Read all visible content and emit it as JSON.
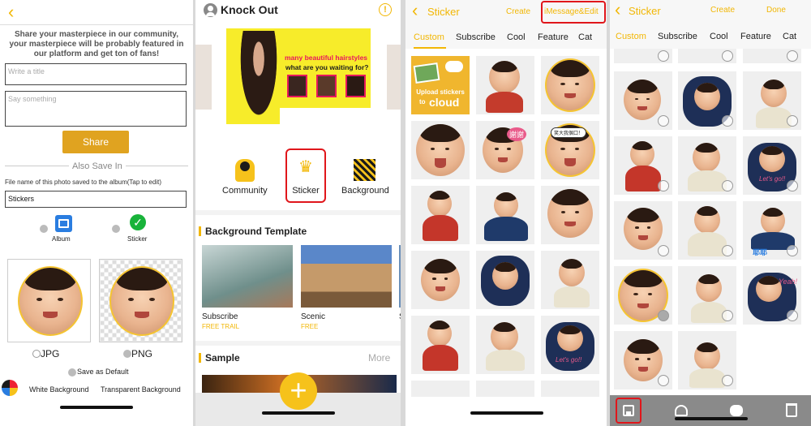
{
  "p1": {
    "back_icon": "chevron-left-icon",
    "intro": "Share your masterpiece in our community, your masterpiece will be probably featured in our platform and get ton of fans!",
    "title_placeholder": "Write a title",
    "say_placeholder": "Say something",
    "share_label": "Share",
    "also_save": "Also Save In",
    "filename_label": "File name of this photo saved to the album(Tap to edit)",
    "filename_value": "Stickers",
    "album_label": "Album",
    "sticker_label": "Sticker",
    "jpg_label": "JPG",
    "png_label": "PNG",
    "save_default": "Save as Default",
    "white_bg": "White Background",
    "transparent_bg": "Transparent Background"
  },
  "p2": {
    "app_title": "Knock Out",
    "banner_line1": "many beautiful hairstyles",
    "banner_line2": "what are you waiting for?",
    "community": "Community",
    "sticker": "Sticker",
    "background": "Background",
    "bg_template_title": "Background Template",
    "templates": [
      {
        "name": "Subscribe",
        "tag": "FREE TRAIL"
      },
      {
        "name": "Scenic",
        "tag": "FREE"
      },
      {
        "name": "S",
        "tag": ""
      }
    ],
    "sample_title": "Sample",
    "more": "More"
  },
  "p3": {
    "title": "Sticker",
    "create": "Create",
    "imessage_edit": "iMessage&Edit",
    "tabs": [
      "Custom",
      "Subscribe",
      "Cool",
      "Feature",
      "Cat"
    ],
    "upload_line1": "Upload stickers",
    "upload_line2": "to",
    "upload_line3": "cloud",
    "bubble1": "謝謝",
    "bubble2": "笑大我個口！",
    "bubble3": "Let's go!!"
  },
  "p4": {
    "title": "Sticker",
    "create": "Create",
    "done": "Done",
    "tabs": [
      "Custom",
      "Subscribe",
      "Cool",
      "Feature",
      "Cat"
    ],
    "bubble1": "Let's go!!",
    "bubble2": "Yeah!",
    "bubble3": "耶耶"
  },
  "colors": {
    "accent": "#f2b705",
    "share_button": "#e0a320",
    "highlight_red": "#e0161b"
  }
}
